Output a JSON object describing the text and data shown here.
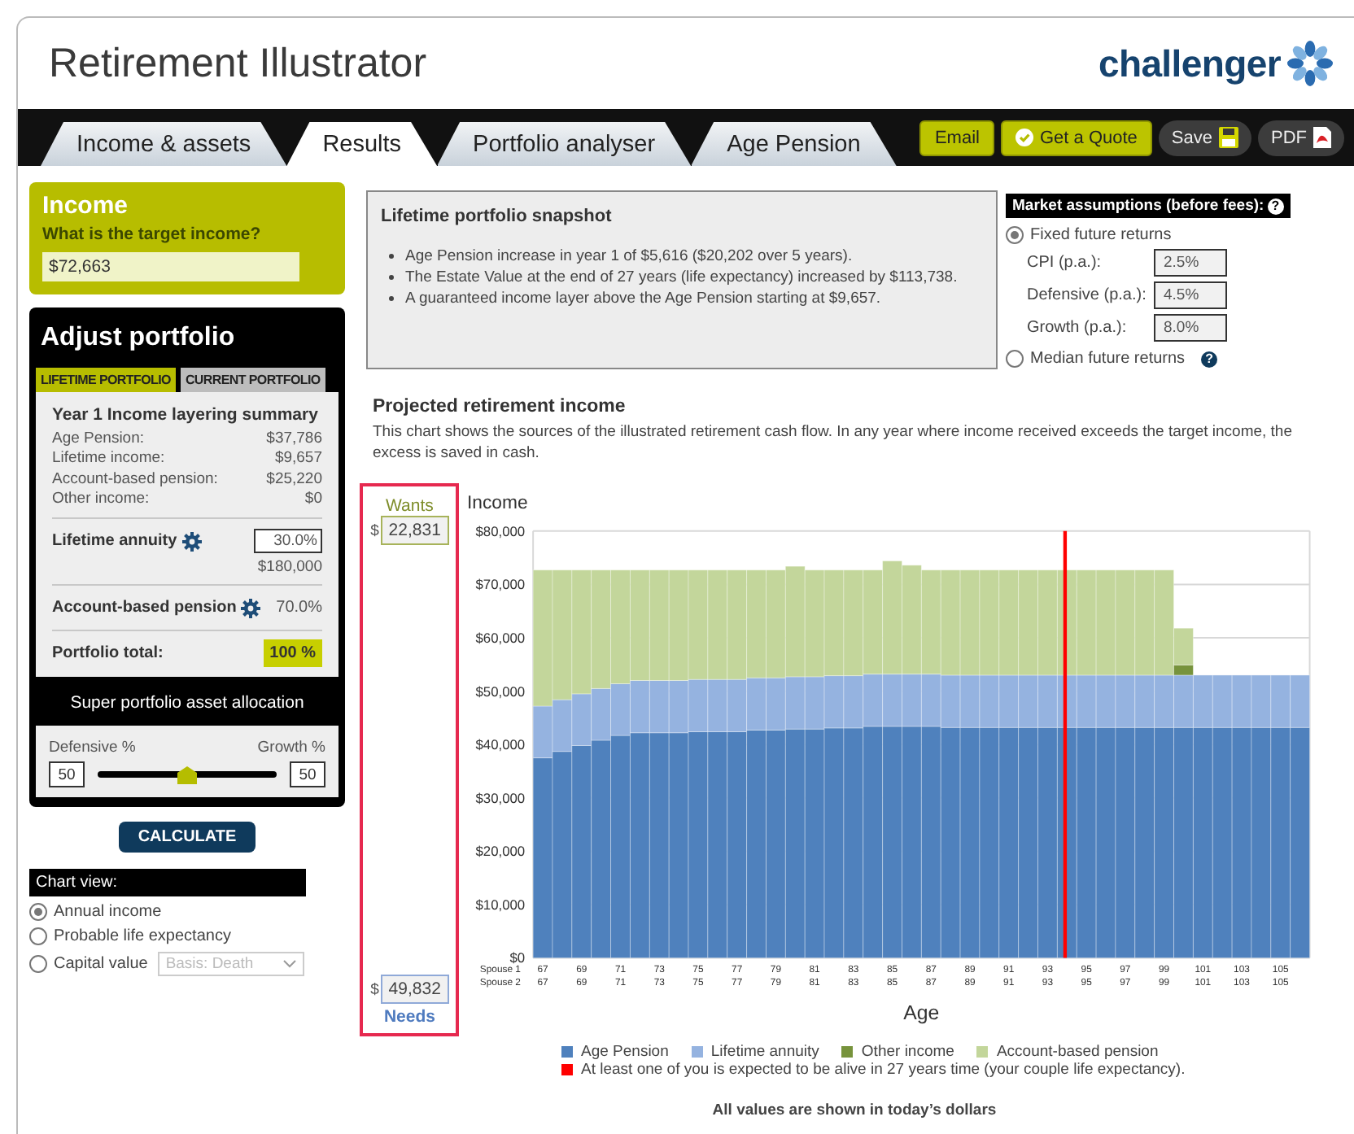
{
  "header": {
    "title": "Retirement Illustrator",
    "logo": "challenger"
  },
  "tabs": [
    {
      "label": "Income & assets",
      "selected": false
    },
    {
      "label": "Results",
      "selected": true
    },
    {
      "label": "Portfolio analyser",
      "selected": false
    },
    {
      "label": "Age Pension",
      "selected": false
    }
  ],
  "actions": [
    {
      "label": "Email",
      "kind": "email"
    },
    {
      "label": "Get a Quote",
      "kind": "quote"
    },
    {
      "label": "Save",
      "kind": "save"
    },
    {
      "label": "PDF",
      "kind": "pdf"
    }
  ],
  "income": {
    "title": "Income",
    "question": "What is the target income?",
    "value": "$72,663"
  },
  "adjust": {
    "title": "Adjust portfolio",
    "tabs": [
      {
        "label": "LIFETIME PORTFOLIO",
        "selected": true
      },
      {
        "label": "CURRENT PORTFOLIO",
        "selected": false
      }
    ],
    "summary_title": "Year 1 Income layering summary",
    "summary": [
      {
        "label": "Age Pension:",
        "value": "$37,786"
      },
      {
        "label": "Lifetime income:",
        "value": "$9,657"
      },
      {
        "label": "Account-based pension:",
        "value": "$25,220"
      },
      {
        "label": "Other income:",
        "value": "$0"
      }
    ],
    "annuity": {
      "label": "Lifetime annuity",
      "value": "30.0%",
      "amount": "$180,000"
    },
    "account": {
      "label": "Account-based pension",
      "value": "70.0%"
    },
    "total": {
      "label": "Portfolio total:",
      "value": "100 %"
    },
    "allocation_title": "Super portfolio asset allocation",
    "allocation": {
      "left_label": "Defensive %",
      "right_label": "Growth %",
      "left_value": "50",
      "right_value": "50",
      "level": 0.5
    }
  },
  "calculate": "CALCULATE",
  "chart_view": {
    "title": "Chart view:",
    "options": [
      {
        "label": "Annual income",
        "selected": true
      },
      {
        "label": "Probable life expectancy",
        "selected": false
      },
      {
        "label": "Capital value",
        "selected": false,
        "select": {
          "value": "Basis: Death",
          "disabled": true
        }
      }
    ]
  },
  "snapshot": {
    "title": "Lifetime portfolio snapshot",
    "items": [
      "Age Pension increase in year 1 of $5,616 ($20,202 over 5 years).",
      "The Estate Value at the end of 27 years (life expectancy) increased by $113,738.",
      "A guaranteed income layer above the Age Pension starting at $9,657."
    ]
  },
  "market": {
    "title": "Market assumptions (before fees):",
    "help": "?",
    "options": [
      {
        "label": "Fixed future returns",
        "selected": true
      },
      {
        "label": "Median future returns",
        "selected": false,
        "help": "?"
      }
    ],
    "rates": [
      {
        "label": "CPI (p.a.):",
        "value": "2.5%"
      },
      {
        "label": "Defensive (p.a.):",
        "value": "4.5%"
      },
      {
        "label": "Growth (p.a.):",
        "value": "8.0%"
      }
    ]
  },
  "projection": {
    "title": "Projected retirement income",
    "description": "This chart shows the sources of the illustrated retirement cash flow. In any year where income received exceeds the target income, the excess is saved in cash."
  },
  "targets": {
    "wants_label": "Wants",
    "wants_currency": "$",
    "wants_value": "22,831",
    "needs_currency": "$",
    "needs_value": "49,832",
    "needs_label": "Needs"
  },
  "chart_data": {
    "type": "bar",
    "stacked": true,
    "ylabel": "Income",
    "xlabel": "Age",
    "ylim": [
      0,
      80000
    ],
    "yticks": [
      {
        "value": 0,
        "label": "$0"
      },
      {
        "value": 10000,
        "label": "$10,000"
      },
      {
        "value": 20000,
        "label": "$20,000"
      },
      {
        "value": 30000,
        "label": "$30,000"
      },
      {
        "value": 40000,
        "label": "$40,000"
      },
      {
        "value": 50000,
        "label": "$50,000"
      },
      {
        "value": 60000,
        "label": "$60,000"
      },
      {
        "value": 70000,
        "label": "$70,000"
      },
      {
        "value": 80000,
        "label": "$80,000"
      }
    ],
    "categories": [
      "67",
      null,
      "69",
      null,
      "71",
      null,
      "73",
      null,
      "75",
      null,
      "77",
      null,
      "79",
      null,
      "81",
      null,
      "83",
      null,
      "85",
      null,
      "87",
      null,
      "89",
      null,
      "91",
      null,
      "93",
      null,
      "95",
      null,
      "97",
      null,
      "99",
      null,
      "101",
      null,
      "103",
      null,
      "105",
      null
    ],
    "series": [
      {
        "name": "Age Pension",
        "color": "#4f81bd",
        "values": [
          37500,
          38700,
          39800,
          40800,
          41700,
          42200,
          42200,
          42200,
          42400,
          42400,
          42400,
          42700,
          42700,
          42900,
          42900,
          43100,
          43100,
          43400,
          43400,
          43400,
          43400,
          43200,
          43200,
          43200,
          43200,
          43200,
          43200,
          43200,
          43200,
          43200,
          43200,
          43200,
          43200,
          43200,
          43200,
          43200,
          43200,
          43200,
          43200,
          43200
        ]
      },
      {
        "name": "Lifetime annuity",
        "color": "#95b3e0",
        "values": [
          9700,
          9700,
          9700,
          9700,
          9700,
          9800,
          9800,
          9800,
          9800,
          9800,
          9800,
          9800,
          9800,
          9800,
          9800,
          9800,
          9800,
          9800,
          9800,
          9800,
          9800,
          9800,
          9800,
          9800,
          9800,
          9800,
          9800,
          9800,
          9800,
          9800,
          9800,
          9800,
          9800,
          9800,
          9800,
          9800,
          9800,
          9800,
          9800,
          9800
        ]
      },
      {
        "name": "Other income",
        "color": "#77933c",
        "values": [
          0,
          0,
          0,
          0,
          0,
          0,
          0,
          0,
          0,
          0,
          0,
          0,
          0,
          0,
          0,
          0,
          0,
          0,
          0,
          0,
          0,
          0,
          0,
          0,
          0,
          0,
          0,
          0,
          0,
          0,
          0,
          0,
          0,
          1900,
          0,
          0,
          0,
          0,
          0,
          0
        ]
      },
      {
        "name": "Account-based pension",
        "color": "#c3d69b",
        "values": [
          25500,
          24300,
          23200,
          22200,
          21300,
          20700,
          20700,
          20700,
          20500,
          20500,
          20500,
          20200,
          20200,
          20700,
          20000,
          19800,
          19800,
          19500,
          21200,
          20400,
          19500,
          19700,
          19700,
          19700,
          19700,
          19700,
          19700,
          19700,
          19700,
          19700,
          19700,
          19700,
          19700,
          6900,
          0,
          0,
          0,
          0,
          0,
          0
        ]
      }
    ]
  },
  "life_expectancy_note": {
    "text": "At least one of you is expected to be alive in 27 years time (your couple life expectancy).",
    "color": "#ff0000"
  },
  "age_rows": [
    {
      "label": "Spouse 1"
    },
    {
      "label": "Spouse 2",
      "ages": [
        "67",
        "69",
        "71",
        "73",
        "75",
        "77",
        "79",
        "81",
        "83",
        "85",
        "87",
        "89",
        "91",
        "93",
        "95",
        "97",
        "99",
        "101",
        "103",
        "105"
      ]
    }
  ],
  "footer": "All values are shown in today’s dollars"
}
